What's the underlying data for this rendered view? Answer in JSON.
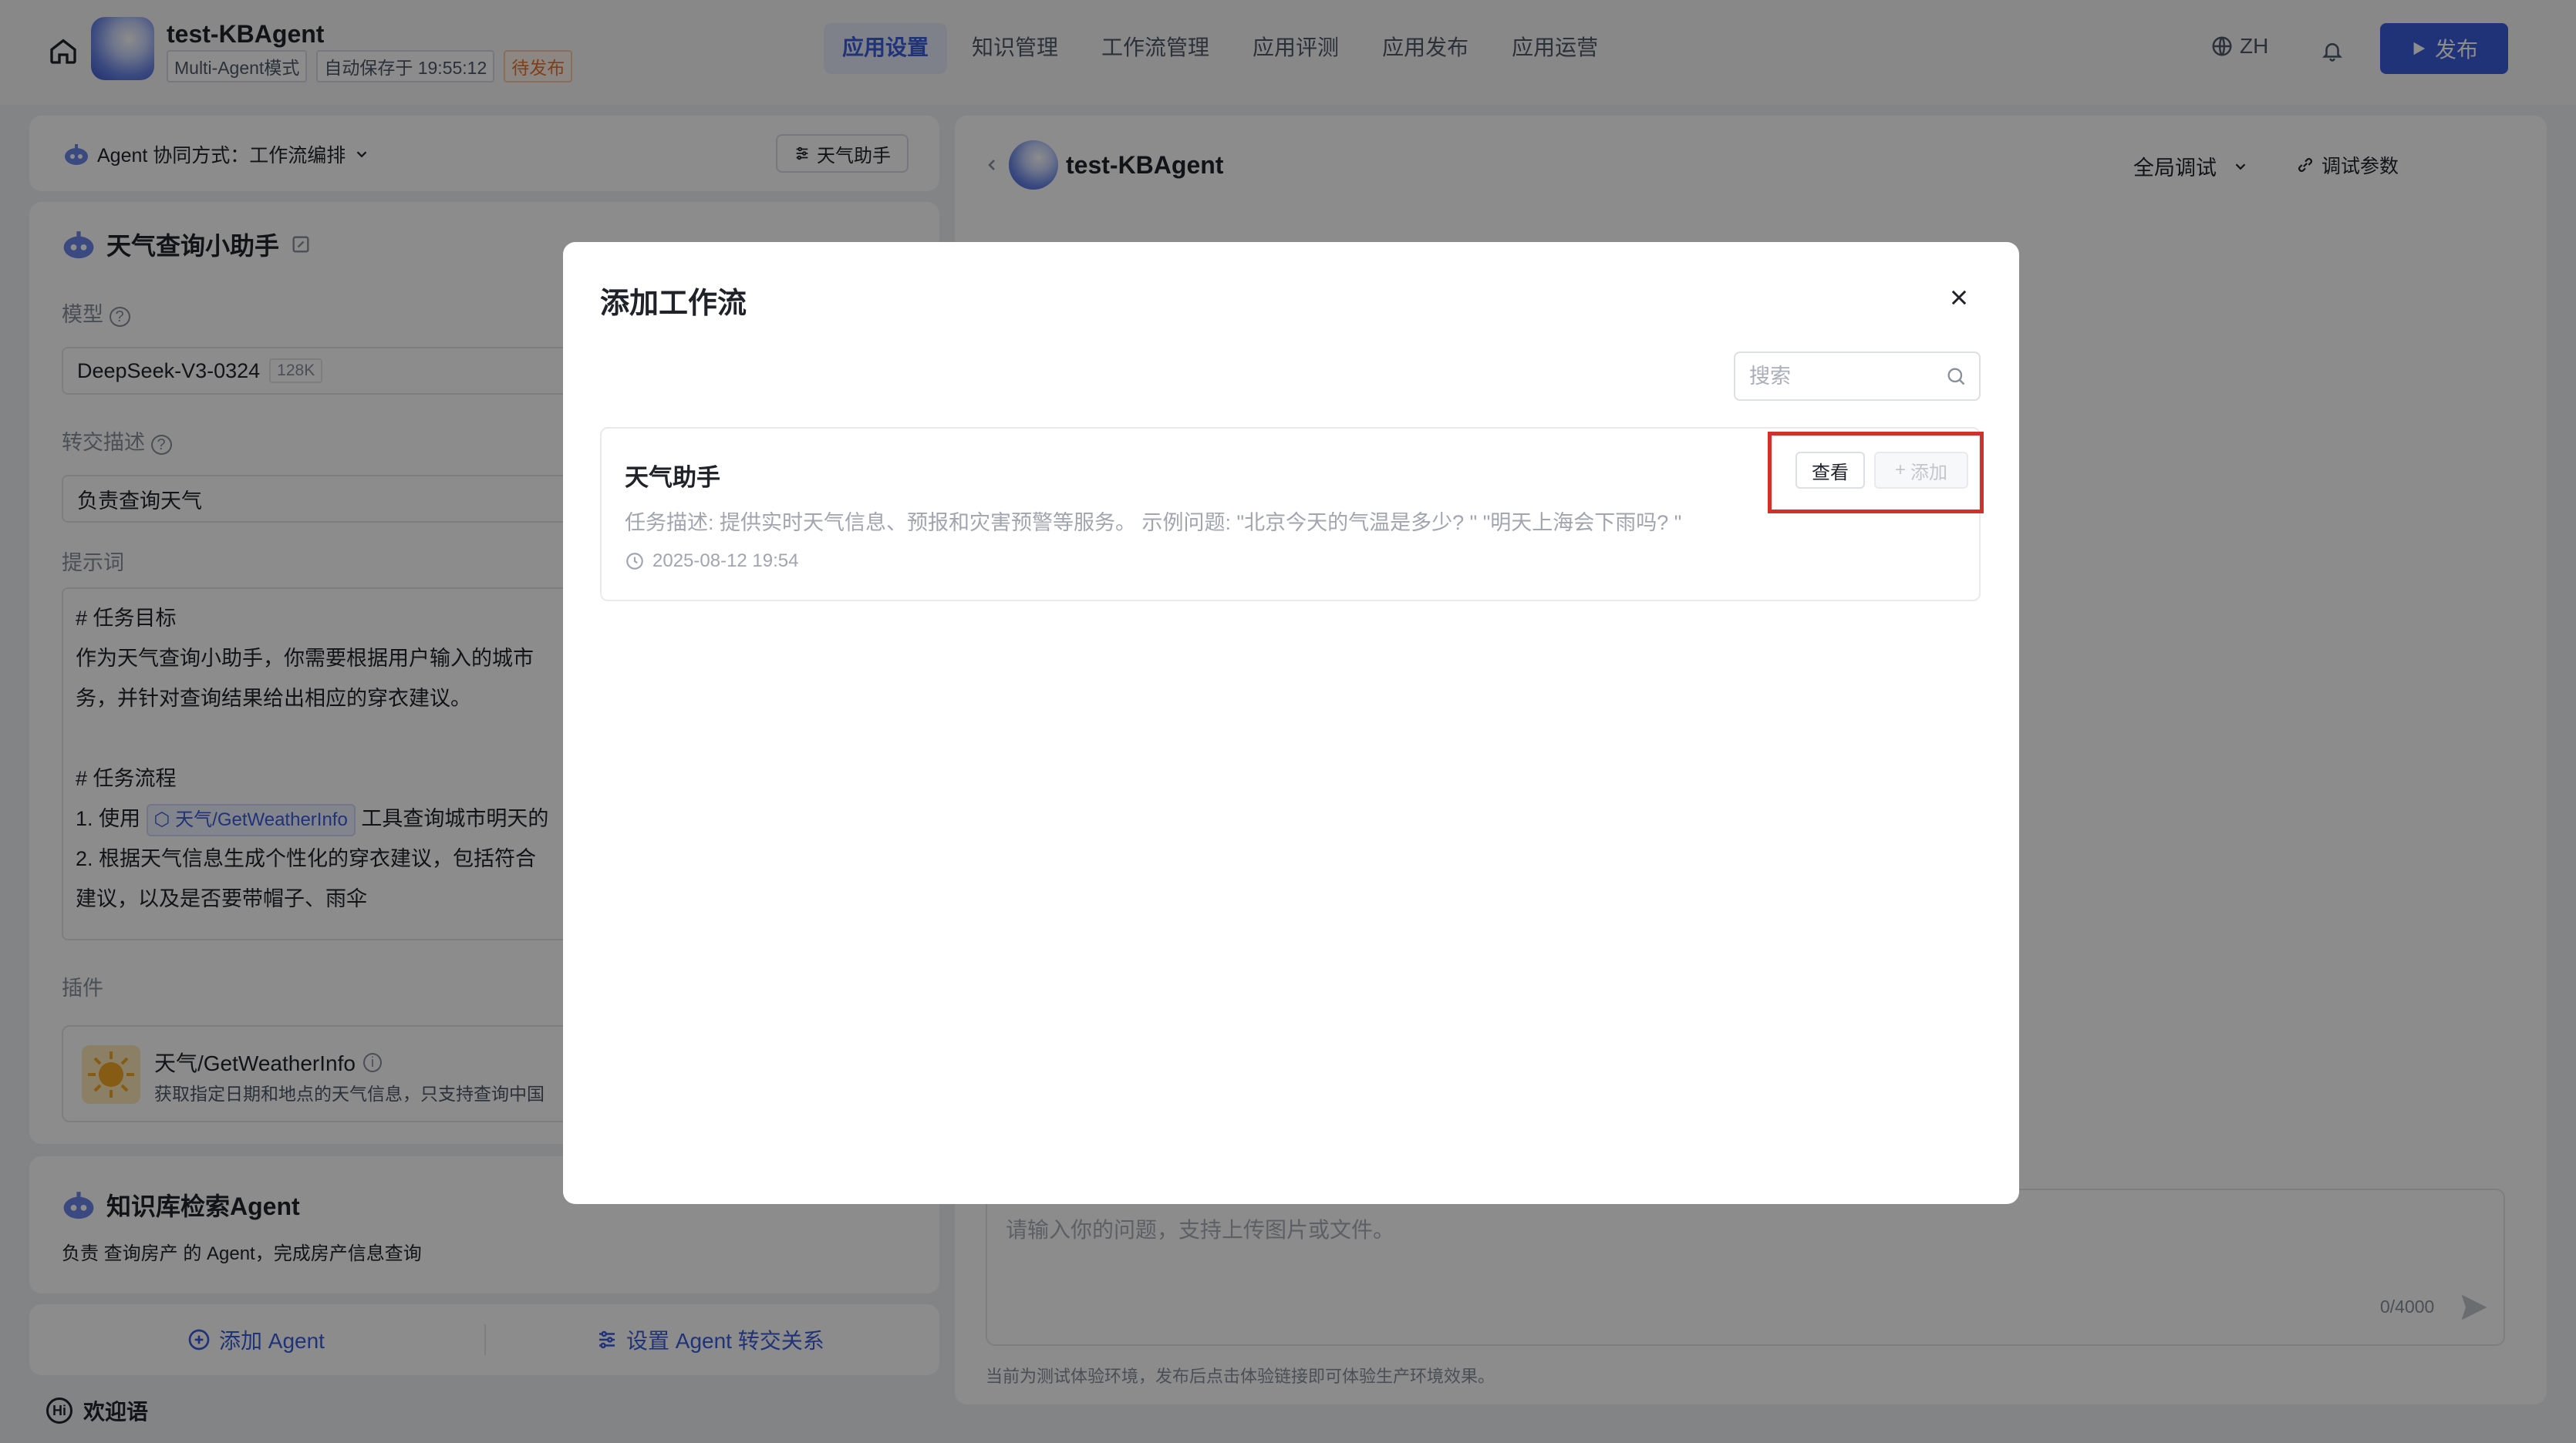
{
  "header": {
    "app_title": "test-KBAgent",
    "mode_tag": "Multi-Agent模式",
    "autosave": "自动保存于 19:55:12",
    "status": "待发布",
    "tabs": [
      "应用设置",
      "知识管理",
      "工作流管理",
      "应用评测",
      "应用发布",
      "应用运营"
    ],
    "active_tab": "应用设置",
    "lang": "ZH",
    "publish_label": "发布"
  },
  "left": {
    "collab_label": "Agent 协同方式：工作流编排",
    "assist_button": "天气助手",
    "agent": {
      "name": "天气查询小助手",
      "model_label": "模型",
      "model_value": "DeepSeek-V3-0324",
      "model_token": "128K",
      "handoff_label": "转交描述",
      "handoff_value": "负责查询天气",
      "prompt_label": "提示词",
      "prompt_lines": {
        "l1": "# 任务目标",
        "l2": "作为天气查询小助手，你需要根据用户输入的城市",
        "l3": "务，并针对查询结果给出相应的穿衣建议。",
        "l4": "# 任务流程",
        "l5a": "1. 使用",
        "l5chip": "天气/GetWeatherInfo",
        "l5b": "工具查询城市明天的",
        "l6": "2. 根据天气信息生成个性化的穿衣建议，包括符合",
        "l7": "建议，以及是否要带帽子、雨伞"
      },
      "plugin_label": "插件",
      "plugin_name": "天气/GetWeatherInfo",
      "plugin_desc": "获取指定日期和地点的天气信息，只支持查询中国"
    },
    "kb_agent": {
      "name": "知识库检索Agent",
      "desc": "负责 查询房产 的 Agent，完成房产信息查询"
    },
    "add_agent": "添加 Agent",
    "set_handoff": "设置 Agent 转交关系",
    "welcome": "欢迎语"
  },
  "right": {
    "title": "test-KBAgent",
    "global_debug": "全局调试",
    "debug_params": "调试参数",
    "input_placeholder": "请输入你的问题，支持上传图片或文件。",
    "counter": "0/4000",
    "footnote": "当前为测试体验环境，发布后点击体验链接即可体验生产环境效果。"
  },
  "modal": {
    "title": "添加工作流",
    "search_placeholder": "搜索",
    "workflow": {
      "name": "天气助手",
      "desc": "任务描述: 提供实时天气信息、预报和灾害预警等服务。 示例问题: \"北京今天的气温是多少? \" \"明天上海会下雨吗? \"",
      "time": "2025-08-12 19:54",
      "view_label": "查看",
      "add_label": "添加"
    }
  },
  "colors": {
    "accent": "#3b5bdb",
    "highlight": "#d0312d",
    "pending": "#e8742d"
  }
}
